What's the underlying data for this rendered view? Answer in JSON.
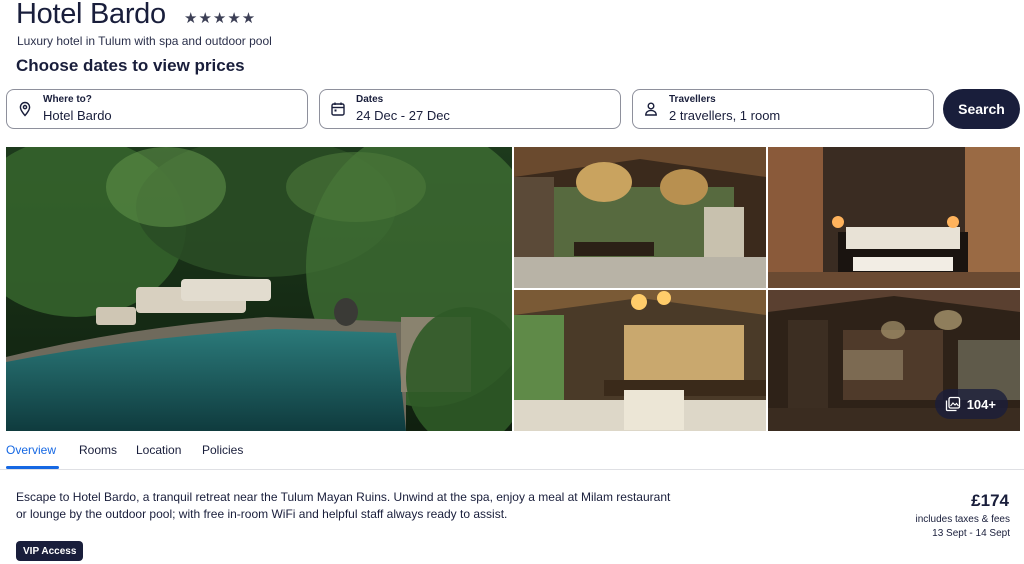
{
  "hotel": {
    "name": "Hotel Bardo",
    "stars": "★★★★★",
    "tagline": "Luxury hotel in Tulum with spa and outdoor pool"
  },
  "search": {
    "heading": "Choose dates to view prices",
    "where_label": "Where to?",
    "where_value": "Hotel Bardo",
    "dates_label": "Dates",
    "dates_value": "24 Dec - 27 Dec",
    "travellers_label": "Travellers",
    "travellers_value": "2 travellers, 1 room",
    "button_label": "Search"
  },
  "gallery": {
    "more_count": "104+"
  },
  "tabs": [
    {
      "label": "Overview"
    },
    {
      "label": "Rooms"
    },
    {
      "label": "Location"
    },
    {
      "label": "Policies"
    }
  ],
  "overview": {
    "description": "Escape to Hotel Bardo, a tranquil retreat near the Tulum Mayan Ruins. Unwind at the spa, enjoy a meal at Milam restaurant or lounge by the outdoor pool; with free in-room WiFi and helpful staff always ready to assist.",
    "badge": "VIP Access"
  },
  "price": {
    "amount": "£174",
    "note": "includes taxes & fees",
    "dates": "13 Sept - 14 Sept"
  },
  "colors": {
    "primary": "#191e3b",
    "accent": "#1668e3"
  }
}
